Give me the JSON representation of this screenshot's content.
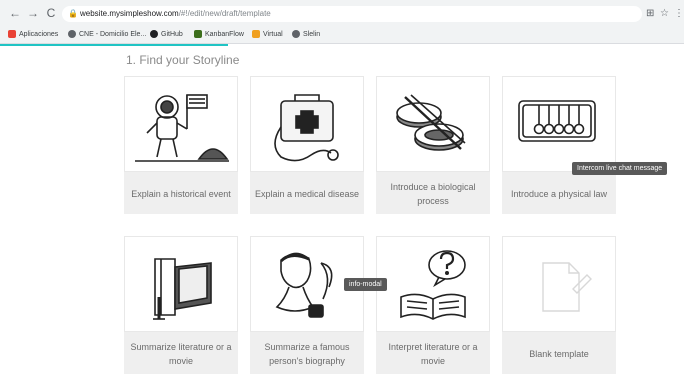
{
  "browser": {
    "url_host": "website.mysimpleshow.com",
    "url_path": "/#!/edit/new/draft/template",
    "bookmarks": [
      {
        "label": "Aplicaciones",
        "color": "#e94235"
      },
      {
        "label": "CNE - Domicilio Ele...",
        "color": "#5f6368"
      },
      {
        "label": "GitHub",
        "color": "#202124"
      },
      {
        "label": "KanbanFlow",
        "color": "#3c6e1c"
      },
      {
        "label": "Virtual",
        "color": "#f0a020"
      },
      {
        "label": "Slelin",
        "color": "#5f6368"
      }
    ],
    "nav": {
      "back": "←",
      "forward": "→",
      "reload": "C"
    },
    "right_icons": {
      "translate": "⊞",
      "star": "☆",
      "menu": "⋮"
    }
  },
  "section_title": "1. Find your Storyline",
  "templates": [
    {
      "label": "Explain a historical event",
      "icon": "astronaut-icon"
    },
    {
      "label": "Explain a medical disease",
      "icon": "medical-kit-icon"
    },
    {
      "label": "Introduce a biological process",
      "icon": "petri-dish-icon"
    },
    {
      "label": "Introduce a physical law",
      "icon": "newtons-cradle-icon"
    },
    {
      "label": "Summarize literature or a movie",
      "icon": "book-clamp-icon"
    },
    {
      "label": "Summarize a famous person's biography",
      "icon": "writer-portrait-icon"
    },
    {
      "label": "Interpret literature or a movie",
      "icon": "book-question-icon"
    },
    {
      "label": "Blank template",
      "icon": "blank-page-icon"
    }
  ],
  "tooltips": {
    "intercom": "Intercom live chat message",
    "info_modal": "info-modal"
  },
  "colors": {
    "progress": "#20c4c4",
    "card_bg": "#efefef",
    "label_text": "#6b6b6b"
  }
}
